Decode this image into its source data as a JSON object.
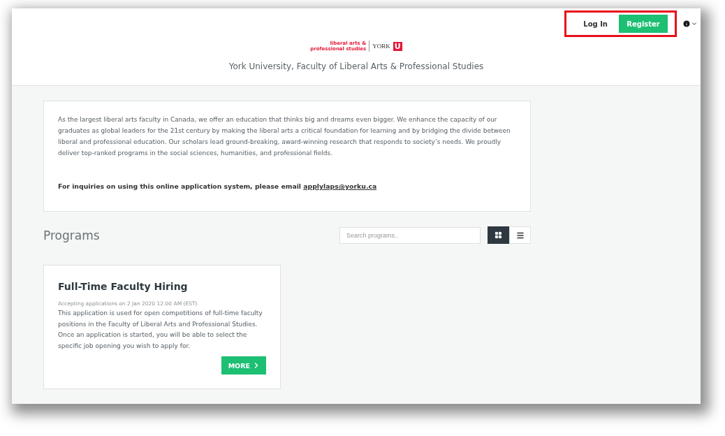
{
  "header": {
    "auth": {
      "login": "Log In",
      "register": "Register",
      "highlighted": true
    },
    "info_menu": {
      "expanded": false
    },
    "logo": {
      "line_1": "liberal arts &",
      "line_2": "professional studies",
      "mark": "YORK",
      "mark_letter": "U"
    },
    "title": "York University, Faculty of Liberal Arts & Professional Studies"
  },
  "intro": {
    "text": "As the largest liberal arts faculty in Canada, we offer an education that thinks big and dreams even bigger. We enhance the capacity of our graduates as global leaders for the 21st century by making the liberal arts a critical foundation for learning and by bridging the divide between liberal and professional education. Our scholars lead ground-breaking, award-winning research that responds to society’s needs. We proudly deliver top-ranked programs in the social sciences, humanities, and professional fields.",
    "inquiry": "For inquiries on using this online application system, please email",
    "email": "applylaps@yorku.ca"
  },
  "programs": {
    "heading": "Programs",
    "search": {
      "placeholder": "Search programs.."
    },
    "views": [
      {
        "kind": "grid",
        "selected": true
      },
      {
        "kind": "list",
        "selected": false
      }
    ],
    "items": [
      {
        "title": "Full-Time Faculty Hiring",
        "accepting": "Accepting applications on 2 Jan 2020 12:00 AM (EST)",
        "description": "This application is used for open competitions of full-time faculty positions in the Faculty of Liberal Arts and Professional Studies. Once an application is started, you will be able to select the specific job opening you wish to apply for.",
        "button": "MORE"
      }
    ]
  }
}
